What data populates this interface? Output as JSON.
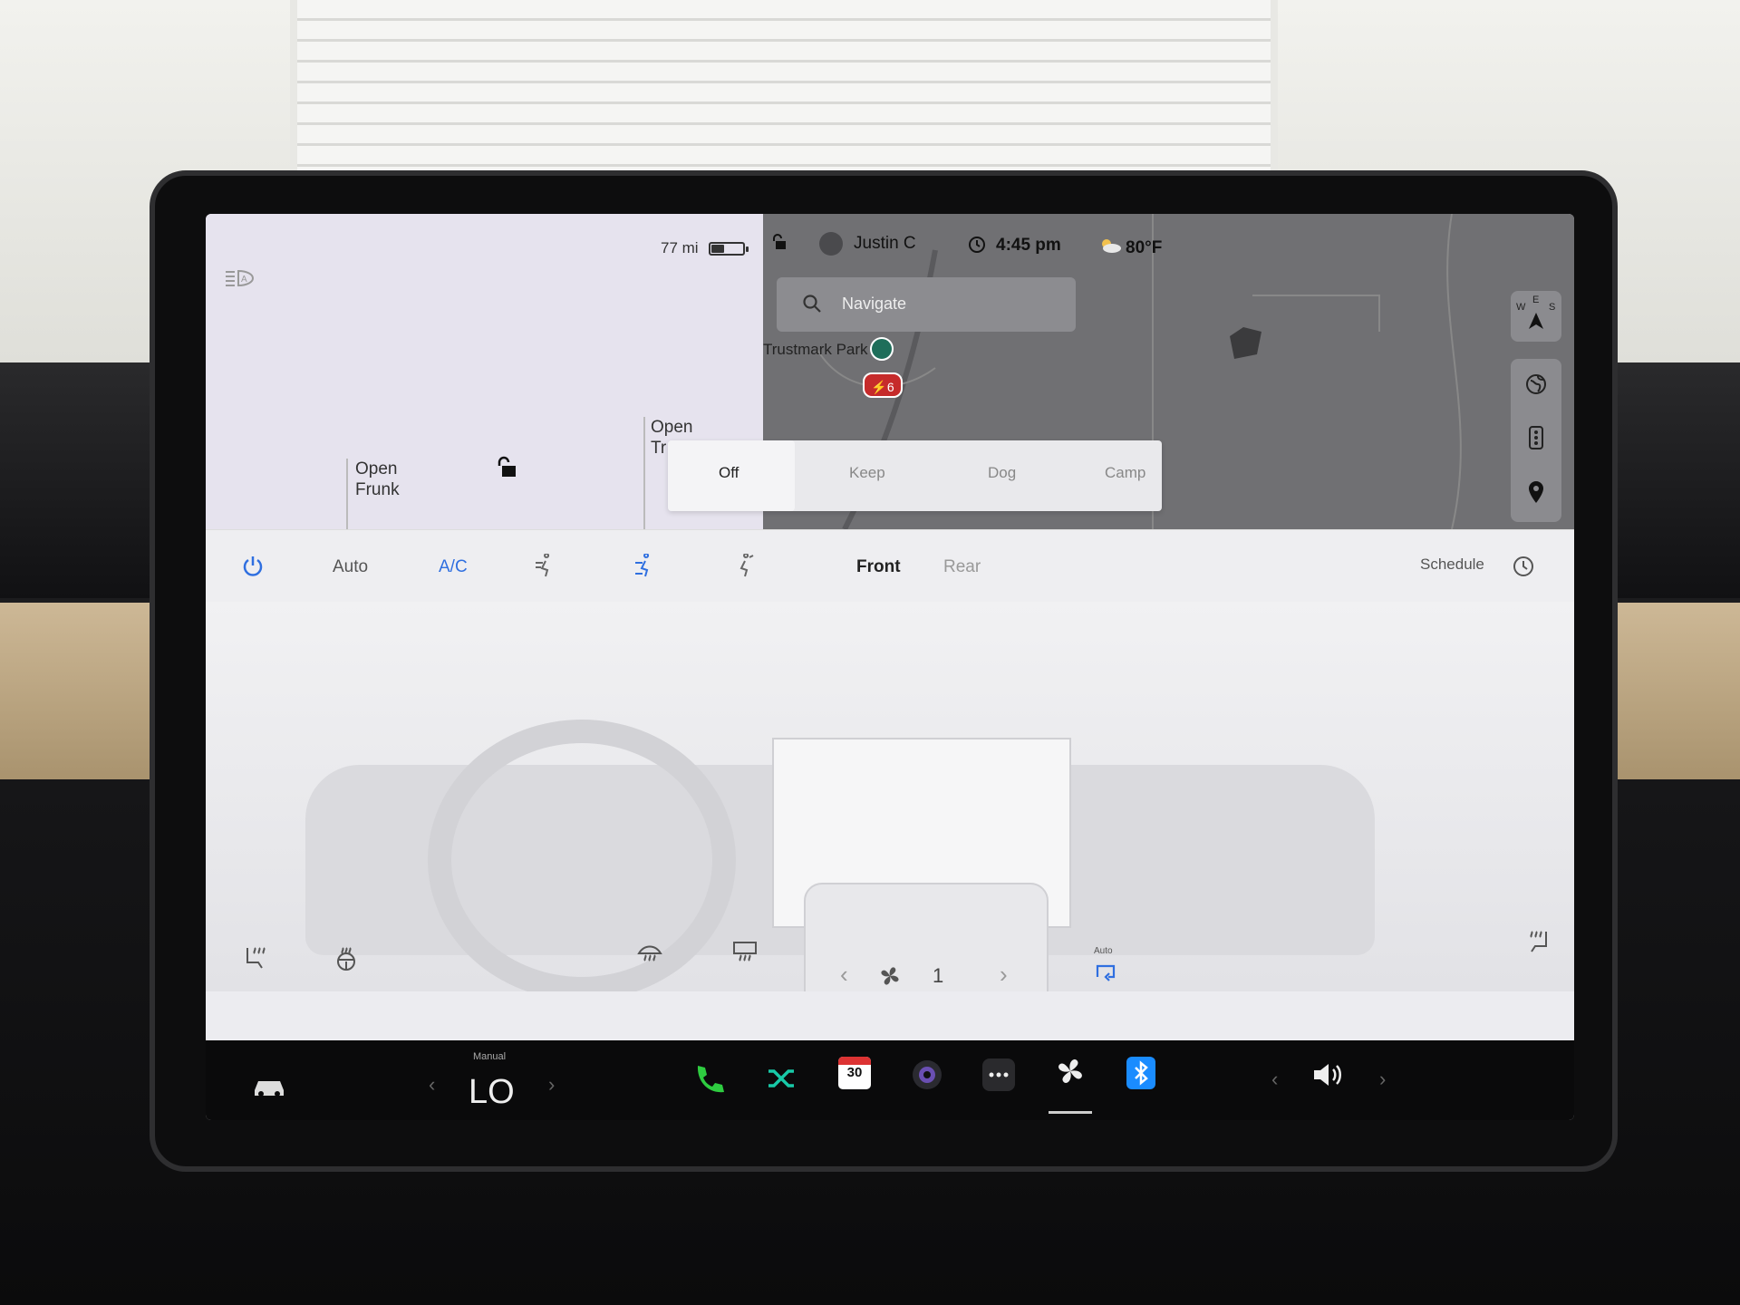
{
  "status": {
    "range": "77 mi",
    "user": "Justin C",
    "time": "4:45 pm",
    "temperature": "80°F"
  },
  "car": {
    "frunk_label_1": "Open",
    "frunk_label_2": "Frunk",
    "trunk_label_1": "Open",
    "trunk_label_2": "Tr"
  },
  "map": {
    "search_placeholder": "Navigate",
    "poi_label": "Trustmark Park",
    "charger_count": "6",
    "compass": {
      "w": "W",
      "e": "E",
      "s": "S"
    }
  },
  "climate_keeper": {
    "options": [
      "Off",
      "Keep",
      "Dog",
      "Camp"
    ],
    "selected": "Off"
  },
  "climate": {
    "auto_label": "Auto",
    "ac_label": "A/C",
    "front_label": "Front",
    "rear_label": "Rear",
    "schedule_label": "Schedule",
    "fan_speed": "1",
    "recirc_label": "Auto"
  },
  "dock": {
    "temp_mode": "Manual",
    "temp_value": "LO",
    "calendar_day": "30"
  }
}
